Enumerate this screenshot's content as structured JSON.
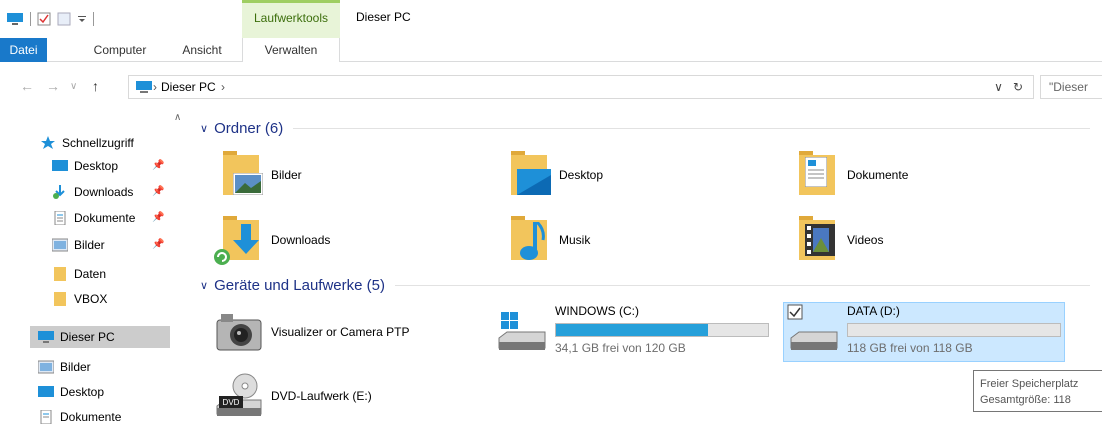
{
  "titlebar": {
    "contextual_tab": "Laufwerktools",
    "window_title": "Dieser PC"
  },
  "ribbon": {
    "tabs": [
      "Datei",
      "Computer",
      "Ansicht",
      "Verwalten"
    ]
  },
  "address": {
    "path": "Dieser PC",
    "search_placeholder": "\"Dieser"
  },
  "sidebar": {
    "items": [
      {
        "label": "Schnellzugriff",
        "icon": "star-icon"
      },
      {
        "label": "Desktop",
        "icon": "desktop-icon",
        "pinned": true
      },
      {
        "label": "Downloads",
        "icon": "downloads-icon",
        "pinned": true
      },
      {
        "label": "Dokumente",
        "icon": "documents-icon",
        "pinned": true
      },
      {
        "label": "Bilder",
        "icon": "pictures-icon",
        "pinned": true
      },
      {
        "label": "Daten",
        "icon": "folder-icon"
      },
      {
        "label": "VBOX",
        "icon": "folder-icon"
      },
      {
        "label": "Dieser PC",
        "icon": "computer-icon",
        "selected": true
      },
      {
        "label": "Bilder",
        "icon": "pictures-icon"
      },
      {
        "label": "Desktop",
        "icon": "desktop-icon"
      },
      {
        "label": "Dokumente",
        "icon": "documents-icon"
      }
    ]
  },
  "groups": {
    "folders": {
      "title": "Ordner (6)",
      "items": [
        {
          "label": "Bilder",
          "icon": "pictures-folder-icon"
        },
        {
          "label": "Desktop",
          "icon": "desktop-folder-icon"
        },
        {
          "label": "Dokumente",
          "icon": "documents-folder-icon"
        },
        {
          "label": "Downloads",
          "icon": "downloads-folder-icon"
        },
        {
          "label": "Musik",
          "icon": "music-folder-icon"
        },
        {
          "label": "Videos",
          "icon": "videos-folder-icon"
        }
      ]
    },
    "devices": {
      "title": "Geräte und Laufwerke (5)",
      "items": [
        {
          "label": "Visualizer or Camera PTP",
          "icon": "camera-icon"
        },
        {
          "label": "WINDOWS (C:)",
          "icon": "windows-drive-icon",
          "free": "34,1 GB frei von 120 GB",
          "used_fraction": 0.716
        },
        {
          "label": "DATA (D:)",
          "icon": "drive-icon",
          "free": "118 GB frei von 118 GB",
          "used_fraction": 0.0,
          "selected": true
        },
        {
          "label": "DVD-Laufwerk (E:)",
          "icon": "dvd-drive-icon"
        }
      ]
    }
  },
  "tooltip": {
    "line1": "Freier Speicherplatz",
    "line2": "Gesamtgröße: 118"
  },
  "colors": {
    "accent": "#1979ca",
    "bar_fill": "#26a0da",
    "selection": "#cce8ff",
    "group_header": "#1e3287"
  }
}
